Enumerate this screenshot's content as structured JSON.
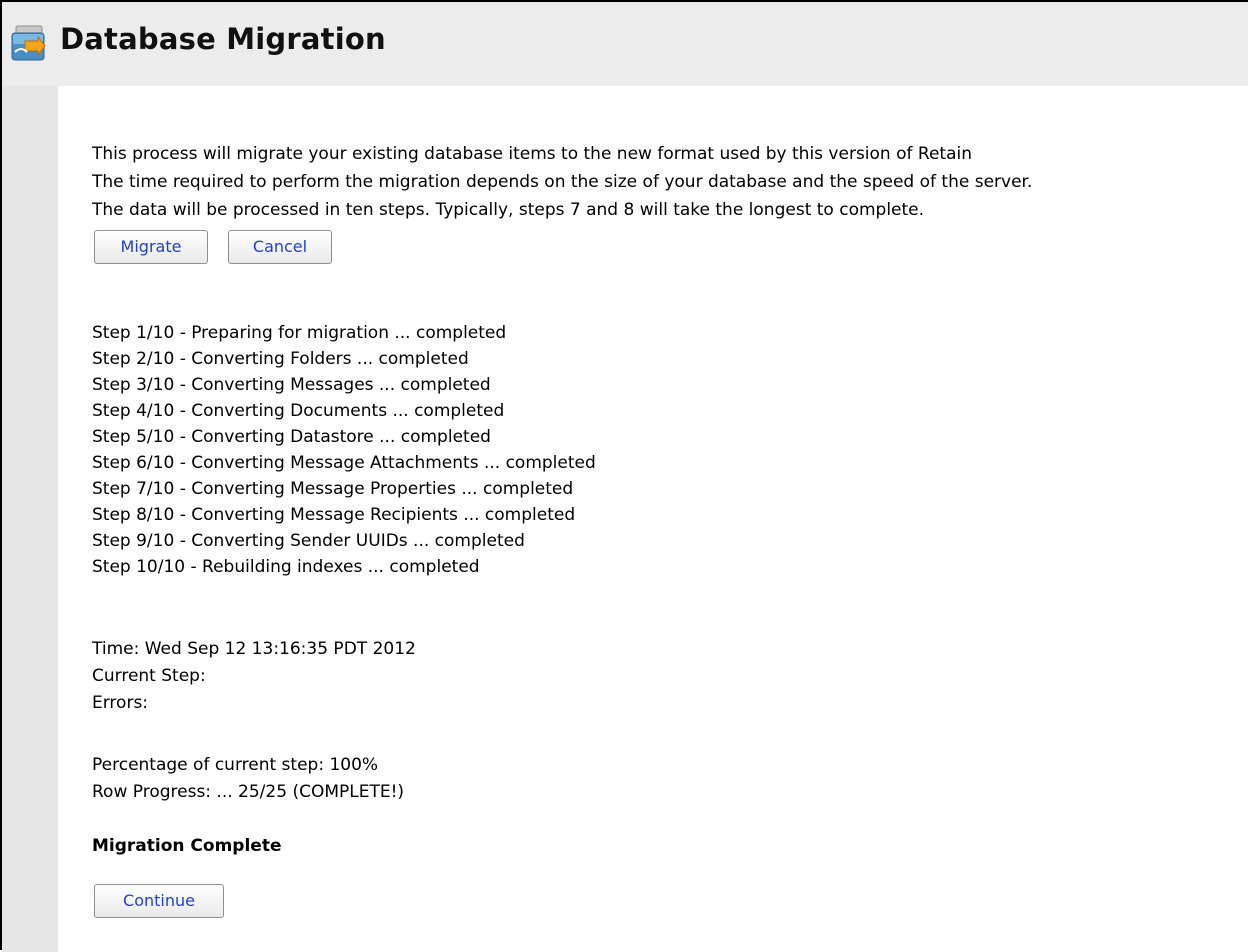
{
  "header": {
    "title": "Database Migration",
    "icon": "database-migration-icon"
  },
  "intro": {
    "line1": "This process will migrate your existing database items to the new format used by this version of Retain",
    "line2": "The time required to perform the migration depends on the size of your database and the speed of the server.",
    "line3": "The data will be processed in ten steps. Typically, steps 7 and 8 will take the longest to complete."
  },
  "buttons": {
    "migrate": "Migrate",
    "cancel": "Cancel",
    "continue": "Continue"
  },
  "steps": [
    "Step 1/10 - Preparing for migration ... completed",
    "Step 2/10 - Converting Folders ... completed",
    "Step 3/10 - Converting Messages ... completed",
    "Step 4/10 - Converting Documents ... completed",
    "Step 5/10 - Converting Datastore ... completed",
    "Step 6/10 - Converting Message Attachments ... completed",
    "Step 7/10 - Converting Message Properties ... completed",
    "Step 8/10 - Converting Message Recipients ... completed",
    "Step 9/10 - Converting Sender UUIDs ... completed",
    "Step 10/10 - Rebuilding indexes ... completed"
  ],
  "status": {
    "time": "Time: Wed Sep 12 13:16:35 PDT 2012",
    "current_step": "Current Step:",
    "errors": "Errors:"
  },
  "progress": {
    "percentage": "Percentage of current step: 100%",
    "rows": "Row Progress: ... 25/25 (COMPLETE!)"
  },
  "completion": {
    "title": "Migration Complete"
  },
  "colors": {
    "header_bg": "#ececec",
    "gutter_bg": "#e6e6e6",
    "button_text": "#1f3fd6"
  }
}
